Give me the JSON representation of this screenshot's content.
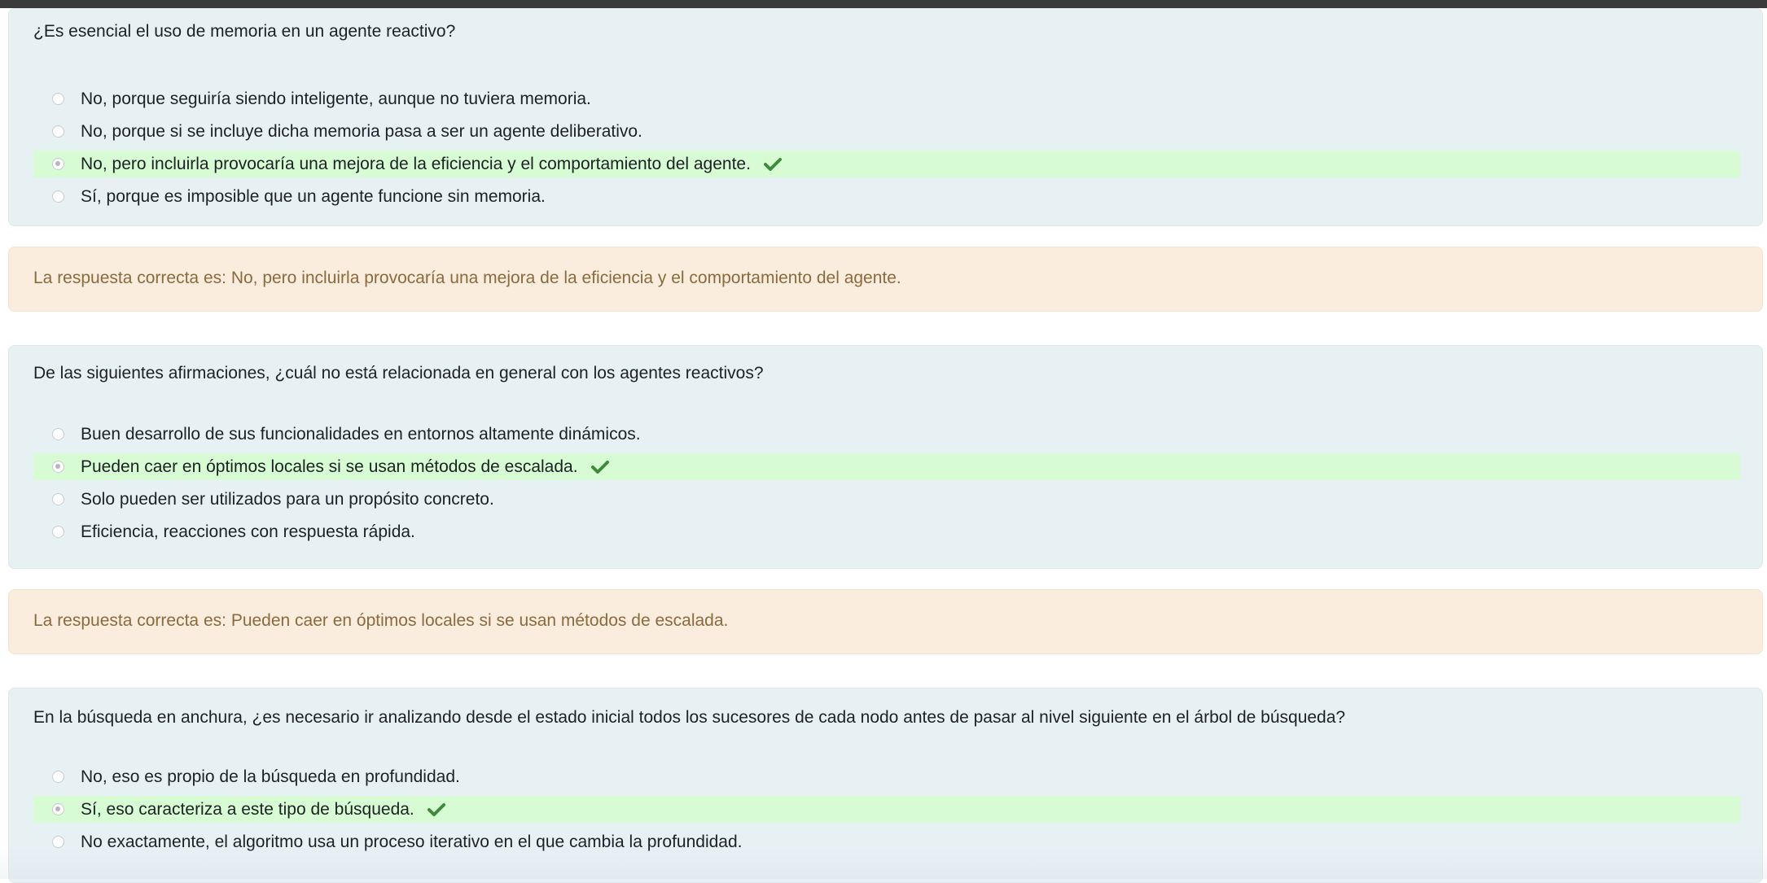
{
  "questions": [
    {
      "text": "¿Es esencial el uso de memoria en un agente reactivo?",
      "options": [
        "No, porque seguiría siendo inteligente, aunque no tuviera memoria.",
        "No, porque si se incluye dicha memoria pasa a ser un agente deliberativo.",
        "No, pero incluirla provocaría una mejora de la eficiencia y el comportamiento del agente.",
        "Sí, porque es imposible que un agente funcione sin memoria."
      ],
      "selected_index": 2,
      "feedback_prefix": "La respuesta correcta es:",
      "feedback_answer": "No, pero incluirla provocaría una mejora de la eficiencia y el comportamiento del agente."
    },
    {
      "text": "De las siguientes afirmaciones, ¿cuál no está relacionada en general con los agentes reactivos?",
      "options": [
        "Buen desarrollo de sus funcionalidades en entornos altamente dinámicos.",
        "Pueden caer en óptimos locales si se usan métodos de escalada.",
        "Solo pueden ser utilizados para un propósito concreto.",
        "Eficiencia, reacciones con respuesta rápida."
      ],
      "selected_index": 1,
      "feedback_prefix": "La respuesta correcta es:",
      "feedback_answer": "Pueden caer en óptimos locales si se usan métodos de escalada."
    },
    {
      "text": "En la búsqueda en anchura,  ¿es necesario ir analizando desde el estado inicial todos los sucesores de cada nodo antes de pasar al nivel siguiente en el árbol de búsqueda?",
      "options": [
        "No, eso es propio de la búsqueda en profundidad.",
        "Sí, eso caracteriza a este tipo de búsqueda.",
        "No exactamente, el algoritmo usa un proceso iterativo en el que cambia la profundidad."
      ],
      "selected_index": 1
    }
  ],
  "colors": {
    "question_bg": "#e7f1f4",
    "correct_bg": "#d7fbd3",
    "feedback_bg": "#fbeddd",
    "feedback_text": "#8a6a3e",
    "check_color": "#3f8a3c"
  }
}
